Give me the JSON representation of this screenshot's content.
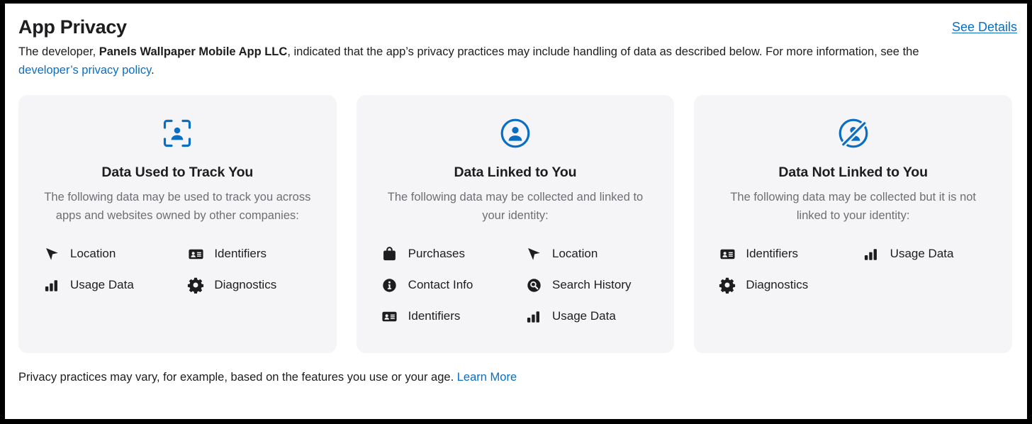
{
  "header": {
    "title": "App Privacy",
    "see_details_label": "See Details"
  },
  "intro": {
    "text_before_developer": "The developer, ",
    "developer_name": "Panels Wallpaper Mobile App LLC",
    "text_after_developer": ", indicated that the app’s privacy practices may include handling of data as described below. For more information, see the ",
    "policy_link_label": "developer’s privacy policy",
    "text_end": "."
  },
  "cards": [
    {
      "icon": "track-person-viewfinder-icon",
      "title": "Data Used to Track You",
      "description": "The following data may be used to track you across apps and websites owned by other companies:",
      "items": [
        {
          "icon": "location-arrow-icon",
          "label": "Location"
        },
        {
          "icon": "identifiers-id-card-icon",
          "label": "Identifiers"
        },
        {
          "icon": "usage-data-bars-icon",
          "label": "Usage Data"
        },
        {
          "icon": "diagnostics-gear-icon",
          "label": "Diagnostics"
        }
      ]
    },
    {
      "icon": "linked-person-circle-icon",
      "title": "Data Linked to You",
      "description": "The following data may be collected and linked to your identity:",
      "items": [
        {
          "icon": "purchases-bag-icon",
          "label": "Purchases"
        },
        {
          "icon": "location-arrow-icon",
          "label": "Location"
        },
        {
          "icon": "contact-info-circle-i-icon",
          "label": "Contact Info"
        },
        {
          "icon": "search-history-magnifier-icon",
          "label": "Search History"
        },
        {
          "icon": "identifiers-id-card-icon",
          "label": "Identifiers"
        },
        {
          "icon": "usage-data-bars-icon",
          "label": "Usage Data"
        }
      ]
    },
    {
      "icon": "not-linked-person-circle-slash-icon",
      "title": "Data Not Linked to You",
      "description": "The following data may be collected but it is not linked to your identity:",
      "items": [
        {
          "icon": "identifiers-id-card-icon",
          "label": "Identifiers"
        },
        {
          "icon": "usage-data-bars-icon",
          "label": "Usage Data"
        },
        {
          "icon": "diagnostics-gear-icon",
          "label": "Diagnostics"
        }
      ]
    }
  ],
  "footer": {
    "text": "Privacy practices may vary, for example, based on the features you use or your age. ",
    "learn_more_label": "Learn More"
  },
  "colors": {
    "accent_blue": "#0a6fc2",
    "card_background": "#f5f5f7",
    "text_primary": "#1d1d1f",
    "text_secondary": "#6e6e73"
  }
}
